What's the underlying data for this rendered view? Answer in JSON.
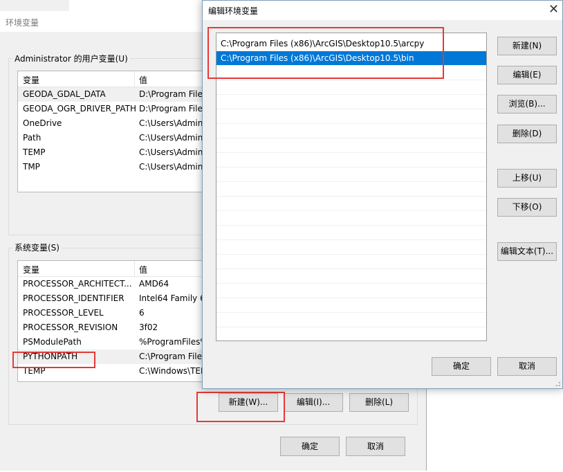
{
  "bg_window": {
    "title": "环境变量",
    "user_vars": {
      "group_label": "Administrator 的用户变量(U)",
      "columns": [
        "变量",
        "值"
      ],
      "rows": [
        {
          "name": "GEODA_GDAL_DATA",
          "value": "D:\\Program File"
        },
        {
          "name": "GEODA_OGR_DRIVER_PATH",
          "value": "D:\\Program File"
        },
        {
          "name": "OneDrive",
          "value": "C:\\Users\\Admin"
        },
        {
          "name": "Path",
          "value": "C:\\Users\\Admin"
        },
        {
          "name": "TEMP",
          "value": "C:\\Users\\Admin"
        },
        {
          "name": "TMP",
          "value": "C:\\Users\\Admin"
        }
      ]
    },
    "system_vars": {
      "group_label": "系统变量(S)",
      "columns": [
        "变量",
        "值"
      ],
      "rows": [
        {
          "name": "PROCESSOR_ARCHITECT...",
          "value": "AMD64"
        },
        {
          "name": "PROCESSOR_IDENTIFIER",
          "value": "Intel64 Family 6"
        },
        {
          "name": "PROCESSOR_LEVEL",
          "value": "6"
        },
        {
          "name": "PROCESSOR_REVISION",
          "value": "3f02"
        },
        {
          "name": "PSModulePath",
          "value": "%ProgramFiles%"
        },
        {
          "name": "PYTHONPATH",
          "value": "C:\\Program File"
        },
        {
          "name": "TEMP",
          "value": "C:\\Windows\\TEM"
        }
      ],
      "buttons": {
        "new": "新建(W)...",
        "edit": "编辑(I)...",
        "delete": "删除(L)"
      }
    },
    "ok": "确定",
    "cancel": "取消"
  },
  "dialog": {
    "title": "编辑环境变量",
    "paths": [
      "C:\\Program Files (x86)\\ArcGIS\\Desktop10.5\\arcpy",
      "C:\\Program Files (x86)\\ArcGIS\\Desktop10.5\\bin"
    ],
    "selected_index": 1,
    "buttons": {
      "new": "新建(N)",
      "edit": "编辑(E)",
      "browse": "浏览(B)...",
      "delete": "删除(D)",
      "up": "上移(U)",
      "down": "下移(O)",
      "edit_text": "编辑文本(T)..."
    },
    "ok": "确定",
    "cancel": "取消"
  },
  "colors": {
    "selection": "#0078d7",
    "highlight_box": "#e53935"
  }
}
